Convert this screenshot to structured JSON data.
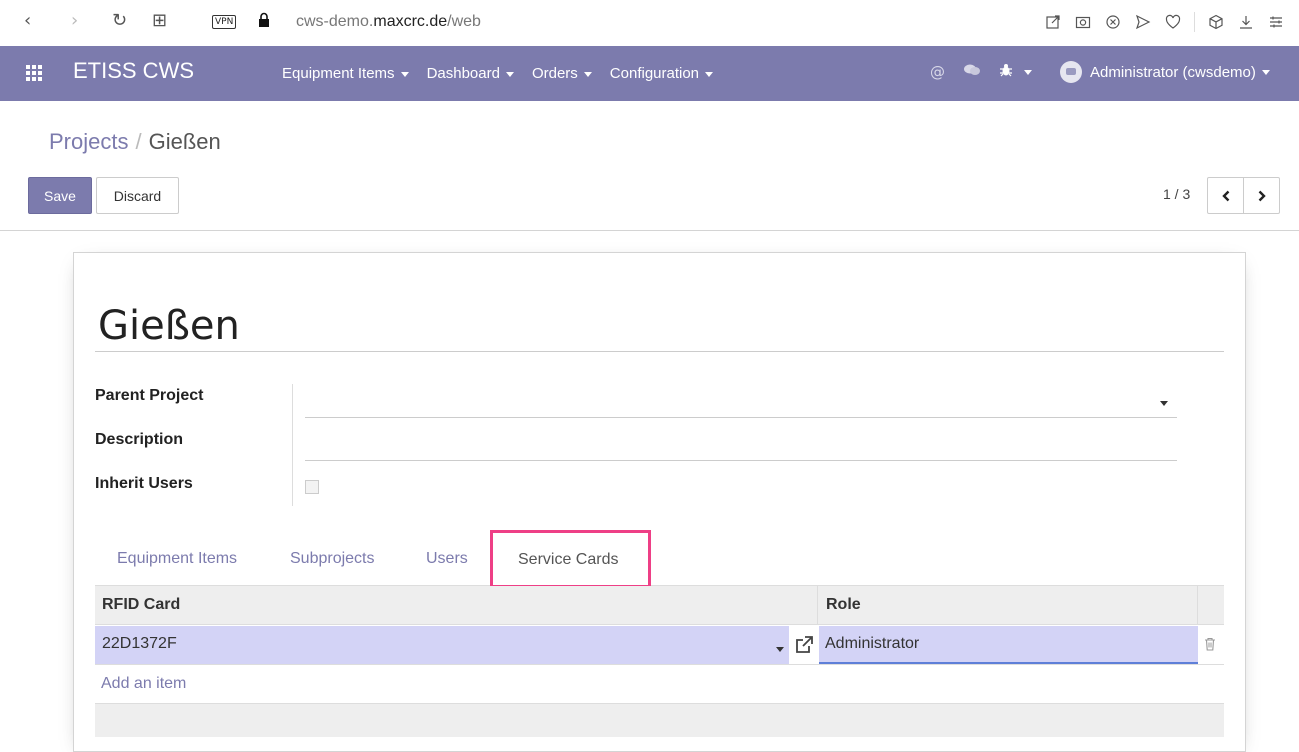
{
  "browser": {
    "back_icon": "‹",
    "forward_icon": "›",
    "reload_icon": "↻",
    "apps_icon": "⊞",
    "vpn_label": "VPN",
    "url_prefix": "cws-demo.",
    "url_domain": "maxcrc.de",
    "url_path": "/web",
    "toolbar_icons": [
      "share-icon",
      "camera-icon",
      "close-circle-icon",
      "send-icon",
      "heart-icon",
      "cube-icon",
      "download-icon",
      "settings-icon"
    ]
  },
  "navbar": {
    "brand": "ETISS CWS",
    "menu": [
      {
        "label": "Equipment Items"
      },
      {
        "label": "Dashboard"
      },
      {
        "label": "Orders"
      },
      {
        "label": "Configuration"
      }
    ],
    "user_name": "Administrator (cwsdemo)"
  },
  "breadcrumb": {
    "parent": "Projects",
    "separator": "/",
    "current": "Gießen"
  },
  "buttons": {
    "save": "Save",
    "discard": "Discard"
  },
  "pager": {
    "value": "1 / 3"
  },
  "form": {
    "title": "Gießen",
    "fields": {
      "parent_project": {
        "label": "Parent Project",
        "value": ""
      },
      "description": {
        "label": "Description",
        "value": ""
      },
      "inherit_users": {
        "label": "Inherit Users",
        "checked": false
      }
    }
  },
  "tabs": [
    {
      "label": "Equipment Items",
      "active": false
    },
    {
      "label": "Subprojects",
      "active": false
    },
    {
      "label": "Users",
      "active": false
    },
    {
      "label": "Service Cards",
      "active": true
    }
  ],
  "table": {
    "columns": [
      "RFID Card",
      "Role"
    ],
    "rows": [
      {
        "rfid_card": "22D1372F",
        "role": "Administrator"
      }
    ],
    "add_item": "Add an item"
  },
  "colors": {
    "brand": "#7c7bad",
    "highlight": "#ee3f86",
    "row_selected": "#d3d3f6"
  }
}
